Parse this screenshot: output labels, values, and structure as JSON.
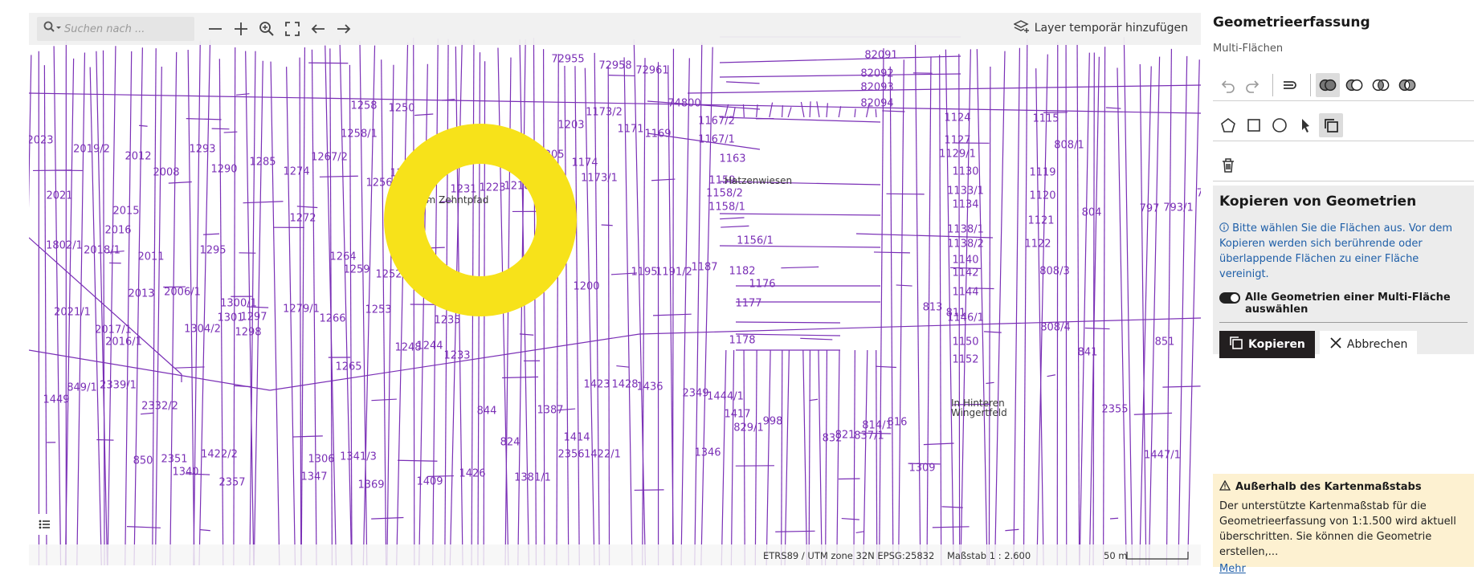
{
  "map": {
    "search_placeholder": "Suchen nach ...",
    "layer_add_label": "Layer temporär hinzufügen",
    "crs_label": "ETRS89 / UTM zone 32N EPSG:25832",
    "scale_label": "Maßstab 1 : 2.600",
    "scalebar_label": "50 m",
    "field_names": [
      "Im Zehntpfad",
      "Hatzenwiesen",
      "In Hinteren Wingertfeld"
    ],
    "parcel_labels": [
      "72955",
      "72958",
      "72961",
      "82091",
      "82092",
      "82093",
      "82094",
      "74800",
      "1167/2",
      "1124",
      "1115",
      "1173/2",
      "1203",
      "1258",
      "1250",
      "1171",
      "1169",
      "1167/1",
      "1127",
      "808/1",
      "1258/1",
      "1163",
      "1129/1",
      "2023",
      "2019/2",
      "2012",
      "1293",
      "1285",
      "1267/2",
      "1242",
      "1174",
      "1130",
      "1119",
      "2008",
      "1290",
      "1274",
      "1256",
      "1231",
      "1223",
      "1218",
      "1205",
      "1173/1",
      "1159",
      "1158/2",
      "1133/1",
      "1120",
      "2021",
      "2015",
      "1158/1",
      "1134",
      "804",
      "797",
      "793/1",
      "790",
      "2016",
      "1272",
      "1121",
      "1138/1",
      "1138/2",
      "1122",
      "1802/1",
      "2018/1",
      "2011",
      "1295",
      "1264",
      "1156/1",
      "1140",
      "808/3",
      "1259",
      "1252",
      "1195",
      "1191/2",
      "1187",
      "1182",
      "1142",
      "2013",
      "2006/1",
      "1200",
      "1176",
      "1144",
      "1300/1",
      "1279/1",
      "1177",
      "813",
      "811",
      "2021/1",
      "1301",
      "1297",
      "1253",
      "1146/1",
      "2017/1",
      "1304/2",
      "1298",
      "1266",
      "1235",
      "808/4",
      "2016/1",
      "1178",
      "1150",
      "851",
      "1248",
      "1244",
      "841",
      "1233",
      "1152",
      "1265",
      "1423",
      "1428",
      "1436",
      "849/1",
      "2339/1",
      "2349",
      "1444/1",
      "1449",
      "2332/2",
      "2355",
      "844",
      "1387",
      "1417",
      "998",
      "816",
      "837/1",
      "829/1",
      "814/1",
      "832",
      "821",
      "824",
      "1414",
      "1422/2",
      "1306",
      "1341/3",
      "1346",
      "1447/1",
      "850",
      "2351",
      "2356",
      "1422/1",
      "1426",
      "1381/1",
      "1409",
      "1369",
      "1347",
      "1340",
      "2357",
      "1309",
      "839"
    ]
  },
  "panel": {
    "title": "Geometrieerfassung",
    "subtitle": "Multi-Flächen",
    "copy_box": {
      "title": "Kopieren von Geometrien",
      "info": "Bitte wählen Sie die Flächen aus. Vor dem Kopieren werden sich berührende oder überlappende Flächen zu einer Fläche vereinigt.",
      "toggle_label": "Alle Geometrien einer Multi-Fläche auswählen",
      "toggle_on": true,
      "copy_button": "Kopieren",
      "cancel_button": "Abbrechen"
    },
    "warning": {
      "title": "Außerhalb des Kartenmaßstabs",
      "text": "Der unterstützte Kartenmaßstab für die Geometrieerfassung von 1:1.500 wird aktuell überschritten. Sie können die Geometrie erstellen,...",
      "more_link": "Mehr"
    }
  },
  "colors": {
    "parcel_line": "#7a2fb6",
    "selection_ring": "#f7e21a",
    "dark_button": "#231f20",
    "info_blue": "#1f5fa8",
    "warning_bg": "#fdf1d1"
  },
  "icons": [
    "search-icon",
    "zoom-out-icon",
    "zoom-in-icon",
    "magnify-icon",
    "fullscreen-icon",
    "back-icon",
    "forward-icon",
    "layer-add-icon",
    "legend-icon",
    "undo-icon",
    "redo-icon",
    "snap-icon",
    "union-icon",
    "difference-icon",
    "intersect-icon",
    "symdiff-icon",
    "polygon-icon",
    "rectangle-icon",
    "circle-icon",
    "select-arrow-icon",
    "copy-icon",
    "trash-icon",
    "info-icon",
    "warning-icon",
    "close-icon"
  ]
}
